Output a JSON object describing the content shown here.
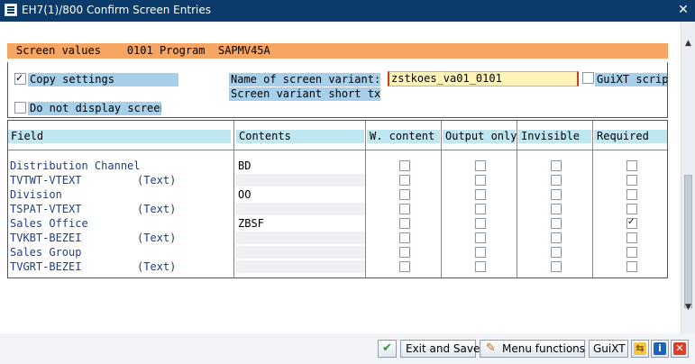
{
  "window": {
    "title": "EH7(1)/800 Confirm Screen Entries",
    "close_glyph": "✕"
  },
  "header": {
    "text": "Screen values    0101 Program  SAPMV45A",
    "color": "#f7a563"
  },
  "settings": {
    "copy_settings": {
      "label": "Copy settings",
      "checked": true
    },
    "do_not_display": {
      "label": "Do not display screen",
      "checked": false
    },
    "variant_name_label": "Name of screen variant:",
    "variant_name_value": "zstkoes_va01_0101",
    "short_txt_label": "Screen variant short txt",
    "short_txt_value": "",
    "guixt": {
      "label": "GuiXT scrip",
      "checked": false
    }
  },
  "table": {
    "columns": [
      "Field",
      "Contents",
      "W. content",
      "Output only",
      "Invisible",
      "Required"
    ],
    "rows": [
      {
        "field": "Distribution Channel",
        "suffix": "",
        "contents": "BD",
        "w_content": false,
        "output_only": false,
        "invisible": false,
        "required": false
      },
      {
        "field": "TVTWT-VTEXT",
        "suffix": "(Text)",
        "contents": "",
        "w_content": false,
        "output_only": false,
        "invisible": false,
        "required": false
      },
      {
        "field": "Division",
        "suffix": "",
        "contents": "OO",
        "w_content": false,
        "output_only": false,
        "invisible": false,
        "required": false
      },
      {
        "field": "TSPAT-VTEXT",
        "suffix": "(Text)",
        "contents": "",
        "w_content": false,
        "output_only": false,
        "invisible": false,
        "required": false
      },
      {
        "field": "Sales Office",
        "suffix": "",
        "contents": "ZBSF",
        "w_content": false,
        "output_only": false,
        "invisible": false,
        "required": true
      },
      {
        "field": "TVKBT-BEZEI",
        "suffix": "(Text)",
        "contents": "",
        "w_content": false,
        "output_only": false,
        "invisible": false,
        "required": false
      },
      {
        "field": "Sales Group",
        "suffix": "",
        "contents": "",
        "w_content": false,
        "output_only": false,
        "invisible": false,
        "required": false
      },
      {
        "field": "TVGRT-BEZEI",
        "suffix": "(Text)",
        "contents": "",
        "w_content": false,
        "output_only": false,
        "invisible": false,
        "required": false
      }
    ]
  },
  "toolbar": {
    "confirm_icon": "check-icon",
    "exit_save_label": "Exit and Save",
    "menu_functions_label": "Menu functions",
    "guixt_label": "GuiXT",
    "icons": [
      "transfer-icon",
      "info-icon",
      "cancel-icon"
    ]
  },
  "colors": {
    "title_bar": "#0a3b6a",
    "label_blue": "#a8cfea",
    "column_header": "#bfe7f2",
    "field_text": "#1d3f8c"
  }
}
